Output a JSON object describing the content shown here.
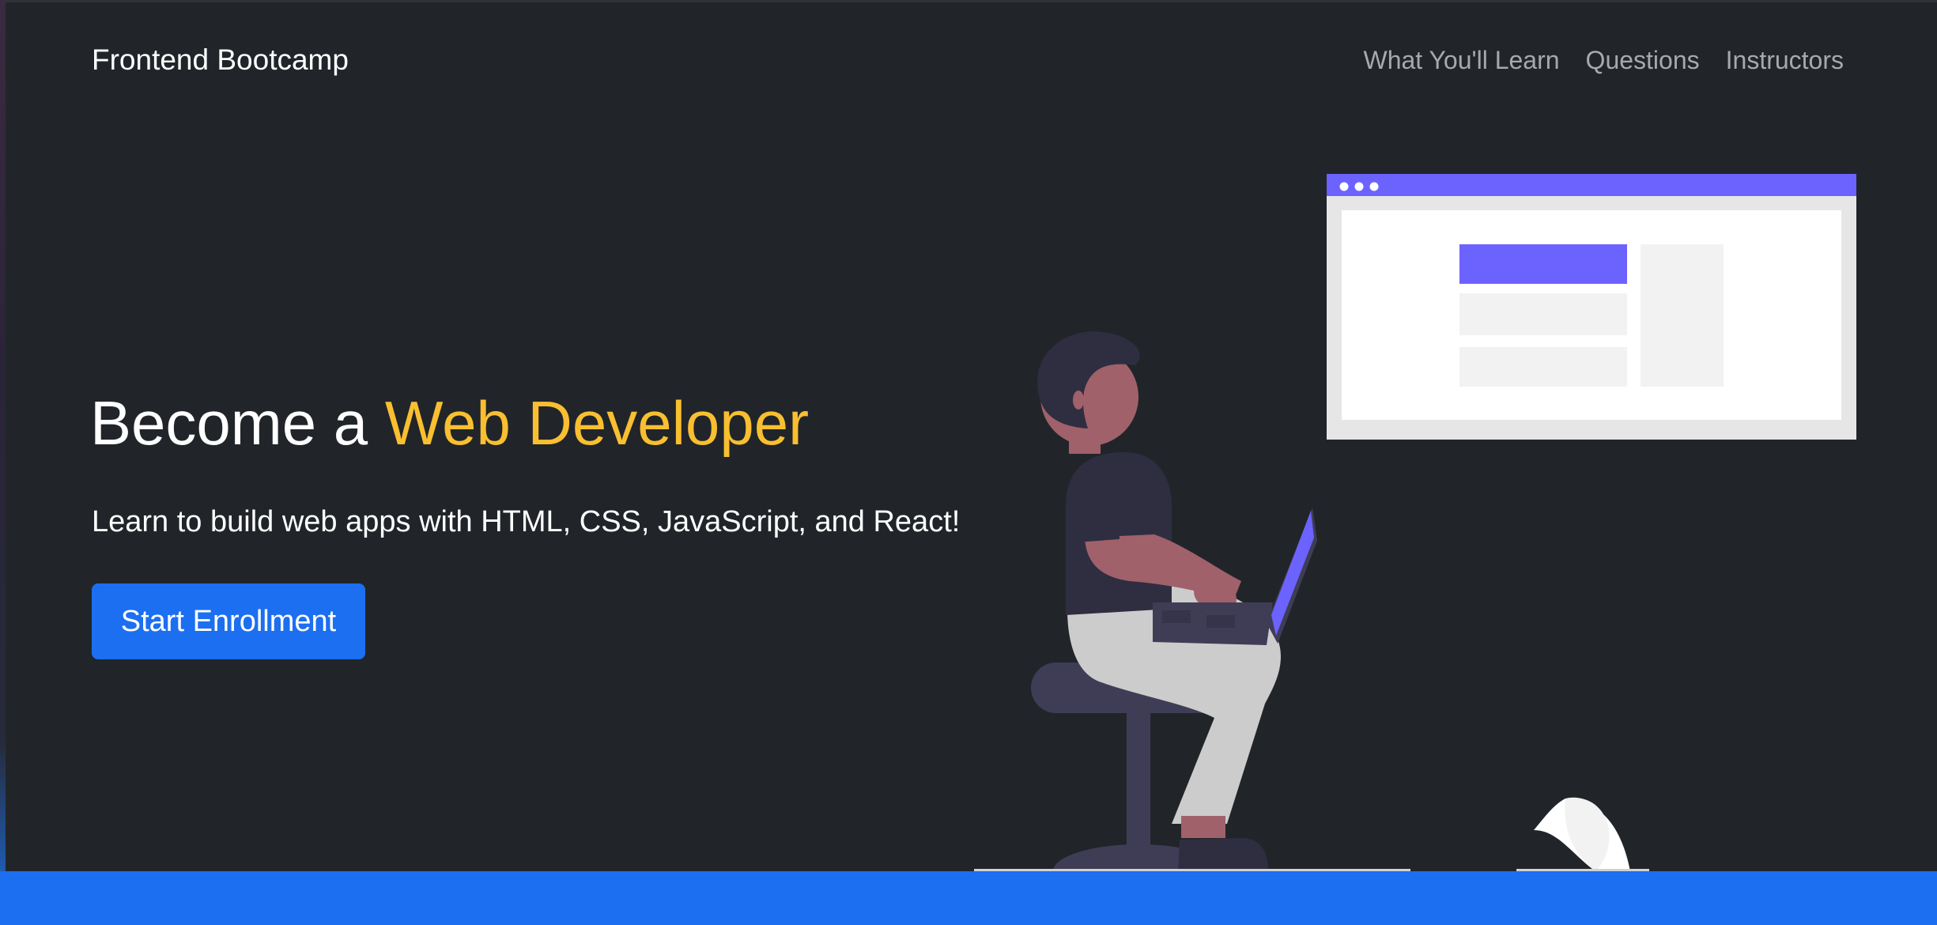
{
  "navbar": {
    "brand": "Frontend Bootcamp",
    "links": [
      {
        "label": "What You'll Learn"
      },
      {
        "label": "Questions"
      },
      {
        "label": "Instructors"
      }
    ]
  },
  "hero": {
    "title_prefix": "Become a ",
    "title_accent": "Web Developer",
    "lead": "Learn to build web apps with HTML, CSS, JavaScript, and React!",
    "cta_label": "Start Enrollment"
  },
  "colors": {
    "background": "#212529",
    "accent_yellow": "#f9bf30",
    "primary_blue": "#1c6ff0",
    "illustration_purple": "#6c63ff"
  }
}
